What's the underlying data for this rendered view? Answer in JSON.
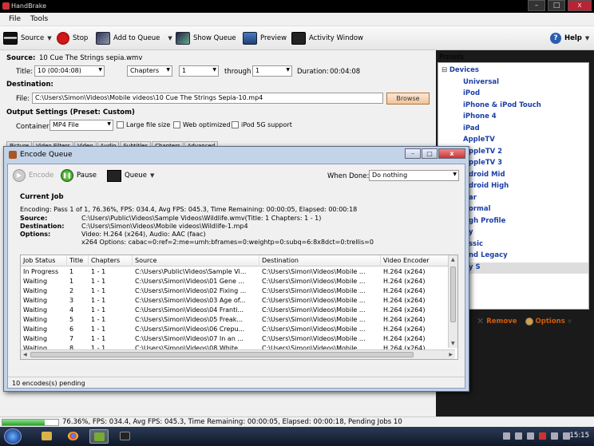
{
  "window": {
    "title": "HandBrake",
    "buttons": [
      "–",
      "□",
      "x"
    ]
  },
  "menu": [
    "File",
    "Tools"
  ],
  "toolbar": {
    "source": "Source",
    "stop": "Stop",
    "add_to_queue": "Add to Queue",
    "show_queue": "Show Queue",
    "preview": "Preview",
    "activity_window": "Activity Window",
    "help": "Help"
  },
  "source": {
    "label": "Source:",
    "value": "10 Cue The Strings sepia.wmv",
    "title_label": "Title:",
    "title_value": "10 (00:04:08)",
    "chapters_value": "Chapters",
    "from_value": "1",
    "through_label": "through",
    "to_value": "1",
    "duration_label": "Duration:",
    "duration_value": "00:04:08"
  },
  "destination": {
    "label": "Destination:",
    "file_label": "File:",
    "file_value": "C:\\Users\\Simon\\Videos\\Mobile videos\\10 Cue The Strings Sepia-10.mp4",
    "browse": "Browse"
  },
  "output": {
    "label": "Output Settings (Preset: Custom)",
    "container_label": "Container:",
    "container_value": "MP4 File",
    "large_file": "Large file size",
    "web_optimized": "Web optimized",
    "ipod": "iPod 5G support"
  },
  "tabs": [
    "Picture",
    "Video Filters",
    "Video",
    "Audio",
    "Subtitles",
    "Chapters",
    "Advanced"
  ],
  "presets": {
    "title": "Presets",
    "group": "Devices",
    "items": [
      "Universal",
      "iPod",
      "iPhone & iPod Touch",
      "iPhone 4",
      "iPad",
      "AppleTV",
      "ppleTV 2",
      "ppleTV 3",
      "droid Mid",
      "droid High",
      "ar",
      "ormal",
      "gh Profile",
      "y",
      "ssic",
      "nd Legacy",
      "y S"
    ],
    "remove": "Remove",
    "options": "Options"
  },
  "statusbar": {
    "text": "76.36%,  FPS: 034.4,  Avg FPS: 045.3,  Time Remaining: 00:00:05,  Elapsed: 00:00:18,  Pending Jobs 10",
    "progress": 0.7636
  },
  "taskbar": {
    "clock": "15:15"
  },
  "queue": {
    "title": "Encode Queue",
    "encode": "Encode",
    "pause": "Pause",
    "queue": "Queue",
    "when_done_label": "When Done:",
    "when_done_value": "Do nothing",
    "current_job_label": "Current Job",
    "progress_line": "Encoding: Pass 1 of 1,  76.36%, FPS: 034.4,  Avg FPS: 045.3,  Time Remaining: 00:00:05,  Elapsed: 00:00:18",
    "source_label": "Source:",
    "source_value": "C:\\Users\\Public\\Videos\\Sample Videos\\Wildlife.wmv(Title: 1 Chapters: 1 - 1)",
    "destination_label": "Destination:",
    "destination_value": "C:\\Users\\Simon\\Videos\\Mobile videos\\Wildlife-1.mp4",
    "options_label": "Options:",
    "options_line1": "Video: H.264 (x264),  Audio: AAC (faac)",
    "options_line2": "x264 Options: cabac=0:ref=2:me=umh:bframes=0:weightp=0:subq=6:8x8dct=0:trellis=0",
    "columns": [
      "Job Status",
      "Title",
      "Chapters",
      "Source",
      "Destination",
      "Video Encoder"
    ],
    "rows": [
      [
        "In Progress",
        "1",
        "1 - 1",
        "C:\\Users\\Public\\Videos\\Sample Vi...",
        "C:\\Users\\Simon\\Videos\\Mobile ...",
        "H.264 (x264)"
      ],
      [
        "Waiting",
        "1",
        "1 - 1",
        "C:\\Users\\Simon\\Videos\\01 Gene ...",
        "C:\\Users\\Simon\\Videos\\Mobile ...",
        "H.264 (x264)"
      ],
      [
        "Waiting",
        "2",
        "1 - 1",
        "C:\\Users\\Simon\\Videos\\02 Fixing ...",
        "C:\\Users\\Simon\\Videos\\Mobile ...",
        "H.264 (x264)"
      ],
      [
        "Waiting",
        "3",
        "1 - 1",
        "C:\\Users\\Simon\\Videos\\03 Age of...",
        "C:\\Users\\Simon\\Videos\\Mobile ...",
        "H.264 (x264)"
      ],
      [
        "Waiting",
        "4",
        "1 - 1",
        "C:\\Users\\Simon\\Videos\\04 Franti...",
        "C:\\Users\\Simon\\Videos\\Mobile ...",
        "H.264 (x264)"
      ],
      [
        "Waiting",
        "5",
        "1 - 1",
        "C:\\Users\\Simon\\Videos\\05 Freak...",
        "C:\\Users\\Simon\\Videos\\Mobile ...",
        "H.264 (x264)"
      ],
      [
        "Waiting",
        "6",
        "1 - 1",
        "C:\\Users\\Simon\\Videos\\06 Crepu...",
        "C:\\Users\\Simon\\Videos\\Mobile ...",
        "H.264 (x264)"
      ],
      [
        "Waiting",
        "7",
        "1 - 1",
        "C:\\Users\\Simon\\Videos\\07 In an ...",
        "C:\\Users\\Simon\\Videos\\Mobile ...",
        "H.264 (x264)"
      ],
      [
        "Waiting",
        "8",
        "1 - 1",
        "C:\\Users\\Simon\\Videos\\08 White ...",
        "C:\\Users\\Simon\\Videos\\Mobile ...",
        "H.264 (x264)"
      ]
    ],
    "pending": "10 encodes(s) pending"
  }
}
